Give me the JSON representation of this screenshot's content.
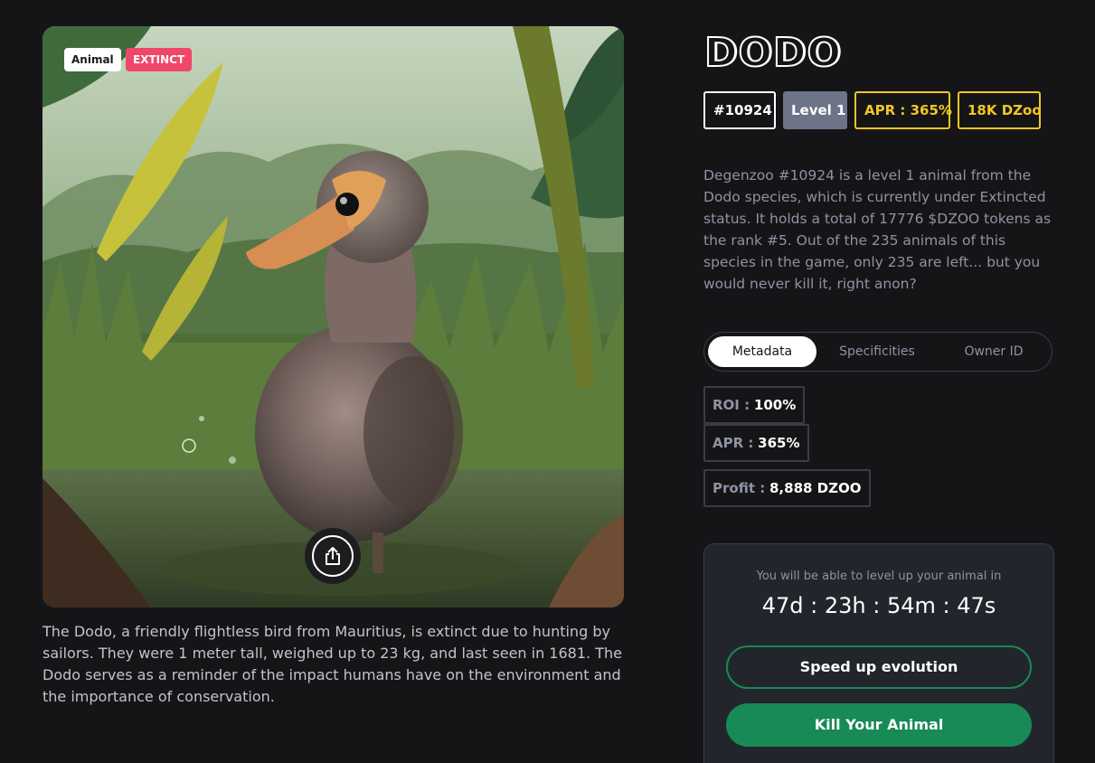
{
  "artwork": {
    "badges": {
      "type": "Animal",
      "status": "EXTINCT"
    },
    "share_icon": "share-icon",
    "colors": {
      "status_badge": "#f0466a",
      "share_button": "#1d1d20"
    }
  },
  "description_left": "The Dodo, a friendly flightless bird from Mauritius, is extinct due to hunting by sailors. They were 1 meter tall, weighed up to 23 kg, and last seen in 1681. The Dodo serves as a reminder of the impact humans have on the environment and the importance of conservation.",
  "header": {
    "title": "DODO",
    "chips": {
      "id": "#10924",
      "level": "Level 1",
      "apr": "APR : 365%",
      "dzoo": "18K DZoo"
    },
    "colors": {
      "accent_gold": "#f3c623",
      "level_bg": "#6e7487"
    }
  },
  "description_right": "Degenzoo #10924 is a level 1 animal from the Dodo species, which is currently under Extincted status. It holds a total of 17776 $DZOO tokens as the rank #5. Out of the 235 animals of this species in the game, only 235 are left... but you would never kill it, right anon?",
  "tabs": [
    "Metadata",
    "Specificities",
    "Owner ID"
  ],
  "active_tab": "Metadata",
  "metadata": {
    "roi": {
      "label": "ROI :",
      "value": "100%"
    },
    "apr": {
      "label": "APR :",
      "value": "365%"
    },
    "profit": {
      "label": "Profit :",
      "value": "8,888 DZOO"
    }
  },
  "evolution": {
    "note": "You will be able to level up your animal in",
    "timer": "47d : 23h : 54m : 47s",
    "speed_button": "Speed up evolution",
    "kill_button": "Kill Your Animal",
    "colors": {
      "button_green": "#178a55"
    }
  }
}
